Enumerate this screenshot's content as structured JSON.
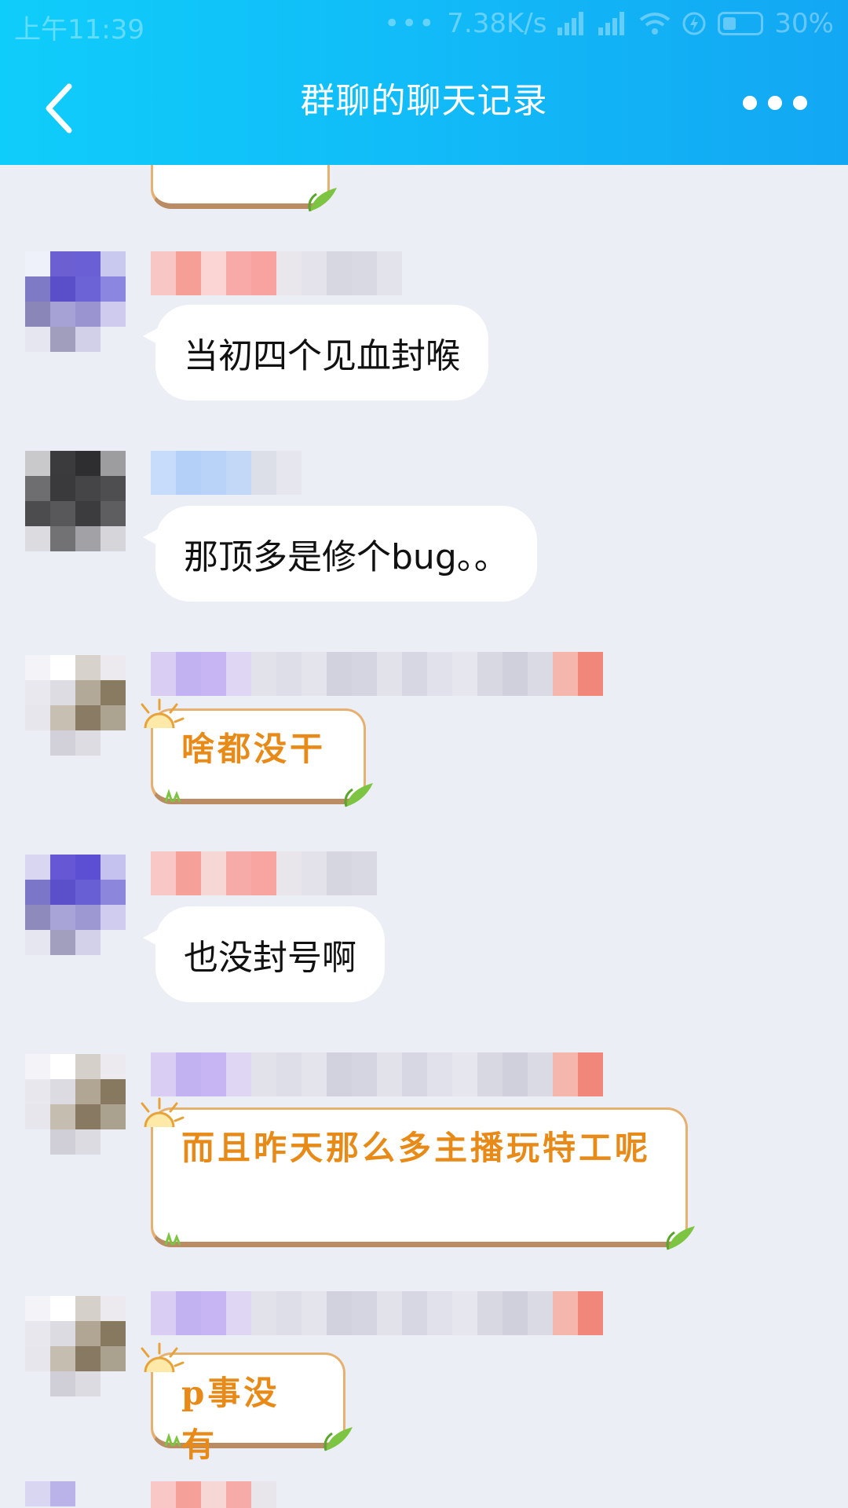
{
  "status_bar": {
    "time": "上午11:39",
    "dots": "•••",
    "speed": "7.38K/s",
    "battery": "30%"
  },
  "header": {
    "title": "群聊的聊天记录"
  },
  "messages": [
    {
      "id": "m1",
      "style": "white",
      "text": "当初四个见血封喉"
    },
    {
      "id": "m2",
      "style": "white",
      "text": "那顶多是修个bug。。"
    },
    {
      "id": "m3",
      "style": "decorated",
      "text": "啥都没干"
    },
    {
      "id": "m4",
      "style": "white",
      "text": "也没封号啊"
    },
    {
      "id": "m5",
      "style": "decorated",
      "text": "而且昨天那么多主播玩特工呢"
    },
    {
      "id": "m6",
      "style": "decorated",
      "text": "p事没有"
    }
  ],
  "colors": {
    "header_gradient_start": "#0fcdfa",
    "header_gradient_end": "#13a7f3",
    "chat_background": "#eceef6",
    "decorated_text": "#e88a18",
    "decorated_border": "#e6b070"
  }
}
